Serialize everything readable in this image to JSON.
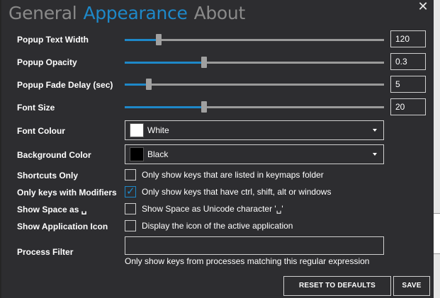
{
  "tabs": [
    {
      "label": "General",
      "active": false
    },
    {
      "label": "Appearance",
      "active": true
    },
    {
      "label": "About",
      "active": false
    }
  ],
  "close_glyph": "✕",
  "sliders": [
    {
      "label": "Popup Text Width",
      "value": "120",
      "fraction": 0.13
    },
    {
      "label": "Popup Opacity",
      "value": "0.3",
      "fraction": 0.305
    },
    {
      "label": "Popup Fade Delay (sec)",
      "value": "5",
      "fraction": 0.093
    },
    {
      "label": "Font Size",
      "value": "20",
      "fraction": 0.305
    }
  ],
  "font_colour": {
    "label": "Font Colour",
    "value": "White",
    "swatch": "#ffffff"
  },
  "background_color": {
    "label": "Background Color",
    "value": "Black",
    "swatch": "#000000"
  },
  "checkboxes": [
    {
      "label": "Shortcuts Only",
      "text": "Only show keys that are listed in keymaps folder",
      "checked": false
    },
    {
      "label": "Only keys with Modifiers",
      "text": "Only show keys that have ctrl, shift, alt or windows",
      "checked": true
    },
    {
      "label": "Show Space as ␣",
      "text": "Show Space as Unicode character '␣'",
      "checked": false
    },
    {
      "label": "Show Application Icon",
      "text": "Display the icon of the active application",
      "checked": false
    }
  ],
  "process_filter": {
    "label": "Process Filter",
    "value": "",
    "hint": "Only show keys from processes matching this regular expression"
  },
  "buttons": {
    "reset": "RESET TO DEFAULTS",
    "save": "SAVE"
  },
  "colors": {
    "accent": "#1e88c8",
    "background": "#2d2d30",
    "track": "#9a9a9a"
  },
  "icons": {
    "close": "close-icon",
    "check": "checkmark-icon",
    "dropdown": "chevron-down-icon"
  }
}
